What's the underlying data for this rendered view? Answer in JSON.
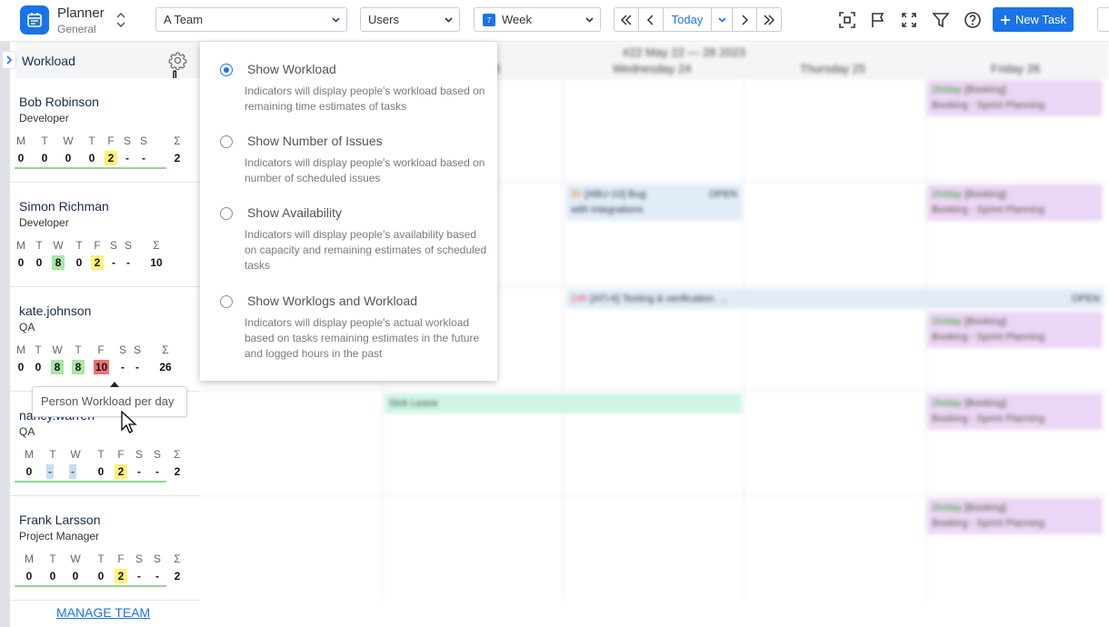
{
  "app": {
    "title": "Planner",
    "subtitle": "General"
  },
  "toolbar": {
    "team_select": "A Team",
    "group_select": "Users",
    "view_select": "Week",
    "today_label": "Today",
    "new_task_label": "New Task",
    "calendar_icon_day": "7"
  },
  "workload": {
    "title": "Workload",
    "manage_team": "MANAGE TEAM",
    "people": [
      {
        "name": "Bob Robinson",
        "role": "Developer",
        "days": [
          "M",
          "T",
          "W",
          "T",
          "F",
          "S",
          "S",
          "Σ"
        ],
        "values": [
          "0",
          "0",
          "0",
          "0",
          "2",
          "-",
          "-",
          "2"
        ],
        "colors": [
          "",
          "",
          "",
          "",
          "yellow",
          "",
          "",
          ""
        ]
      },
      {
        "name": "Simon Richman",
        "role": "Developer",
        "days": [
          "M",
          "T",
          "W",
          "T",
          "F",
          "S",
          "S",
          "Σ"
        ],
        "values": [
          "0",
          "0",
          "8",
          "0",
          "2",
          "-",
          "-",
          "10"
        ],
        "colors": [
          "",
          "",
          "green",
          "",
          "yellow",
          "",
          "",
          ""
        ]
      },
      {
        "name": "kate.johnson",
        "role": "QA",
        "days": [
          "M",
          "T",
          "W",
          "T",
          "F",
          "S",
          "S",
          "Σ"
        ],
        "values": [
          "0",
          "0",
          "8",
          "8",
          "10",
          "-",
          "-",
          "26"
        ],
        "colors": [
          "",
          "",
          "green",
          "green",
          "red",
          "",
          "",
          ""
        ]
      },
      {
        "name": "nancy.warren",
        "role": "QA",
        "days": [
          "M",
          "T",
          "W",
          "T",
          "F",
          "S",
          "S",
          "Σ"
        ],
        "values": [
          "0",
          "-",
          "-",
          "0",
          "2",
          "-",
          "-",
          "2"
        ],
        "colors": [
          "",
          "blue",
          "blue",
          "",
          "yellow",
          "",
          "",
          ""
        ]
      },
      {
        "name": "Frank Larsson",
        "role": "Project Manager",
        "days": [
          "M",
          "T",
          "W",
          "T",
          "F",
          "S",
          "S",
          "Σ"
        ],
        "values": [
          "0",
          "0",
          "0",
          "0",
          "2",
          "-",
          "-",
          "2"
        ],
        "colors": [
          "",
          "",
          "",
          "",
          "yellow",
          "",
          "",
          ""
        ]
      }
    ],
    "tooltip": "Person Workload per day"
  },
  "calendar": {
    "range": "#22 May 22 — 28 2023",
    "days": [
      "3",
      "Wednesday 24",
      "Thursday 25",
      "Friday 26"
    ],
    "events": {
      "booking_rate": "2h/day",
      "booking_title": "[Booking]",
      "booking_sub": "Booking - Sprint Planning",
      "bug_est": "8h",
      "bug_title": "[ABU-10] Bug",
      "bug_sub": "with integrations",
      "bug_status": "OPEN",
      "test_est": "24h",
      "test_title": "[ATI-6] Testing & verification. ...",
      "test_status": "OPEN",
      "sick_leave": "Sick Leave"
    }
  },
  "workload_menu": {
    "options": [
      {
        "label": "Show Workload",
        "desc": "Indicators will display people's workload based on remaining time estimates of tasks",
        "selected": true
      },
      {
        "label": "Show Number of Issues",
        "desc": "Indicators will display people's workload based on number of scheduled issues",
        "selected": false
      },
      {
        "label": "Show Availability",
        "desc": "Indicators will display people's availability based on capacity and remaining estimates of scheduled tasks",
        "selected": false
      },
      {
        "label": "Show Worklogs and Workload",
        "desc": "Indicators will display people's actual workload based on tasks remaining estimates in the future and logged hours in the past",
        "selected": false
      }
    ]
  },
  "icons": [
    "planner-icon",
    "chevron-down-icon",
    "calendar-icon",
    "double-chevron-left-icon",
    "chevron-left-icon",
    "chevron-right-icon",
    "double-chevron-right-icon",
    "focus-icon",
    "flag-icon",
    "fullscreen-icon",
    "filter-icon",
    "help-icon",
    "plus-icon",
    "gear-icon",
    "hand-cursor-icon",
    "arrow-cursor-icon"
  ],
  "colors": {
    "accent": "#1a73e8",
    "yellow": "#fff176",
    "green": "#a5e8a5",
    "red": "#f07070",
    "booking": "#ecd6f5"
  }
}
